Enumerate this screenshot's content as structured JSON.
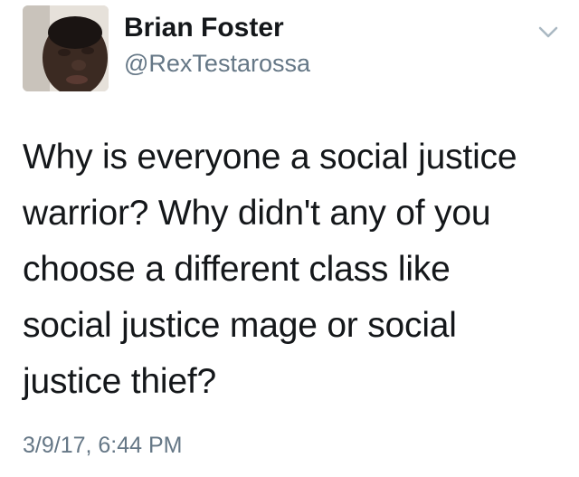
{
  "tweet": {
    "author": {
      "display_name": "Brian Foster",
      "handle": "@RexTestarossa",
      "avatar_icon": "user-avatar"
    },
    "menu_icon": "chevron-down-icon",
    "text_lines": [
      "Why is everyone a social justice",
      "warrior? Why didn't any of you",
      "choose a different class like",
      "social justice mage or social",
      "justice thief?"
    ],
    "timestamp": "3/9/17, 6:44 PM"
  },
  "colors": {
    "primary_text": "#14171a",
    "secondary_text": "#657786",
    "chevron": "#aab8c2"
  }
}
